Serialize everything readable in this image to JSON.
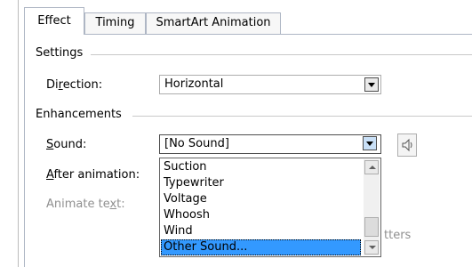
{
  "tabs": [
    {
      "label": "Effect",
      "active": true
    },
    {
      "label": "Timing",
      "active": false
    },
    {
      "label": "SmartArt Animation",
      "active": false
    }
  ],
  "settings": {
    "group_label": "Settings",
    "direction_label_pre": "Di",
    "direction_label_ul": "r",
    "direction_label_post": "ection:",
    "direction_value": "Horizontal"
  },
  "enhancements": {
    "group_label": "Enhancements",
    "sound_label_ul": "S",
    "sound_label_post": "ound:",
    "sound_value": "[No Sound]",
    "after_label_ul": "A",
    "after_label_post": "fter animation:",
    "animate_label_pre": "Animate te",
    "animate_label_ul": "x",
    "animate_label_post": "t:",
    "hidden_partial_text": "tters"
  },
  "sound_list": {
    "items": [
      "Suction",
      "Typewriter",
      "Voltage",
      "Whoosh",
      "Wind",
      "Other Sound..."
    ],
    "selected": "Other Sound..."
  },
  "icons": {
    "sound_preview": "speaker-icon",
    "dropdown": "chevron-down-icon",
    "scroll_up": "arrow-up-icon",
    "scroll_down": "arrow-down-icon"
  },
  "colors": {
    "selection": "#3399ff",
    "tab_border": "#aeb6c4",
    "disabled_text": "#8f8f8f"
  }
}
